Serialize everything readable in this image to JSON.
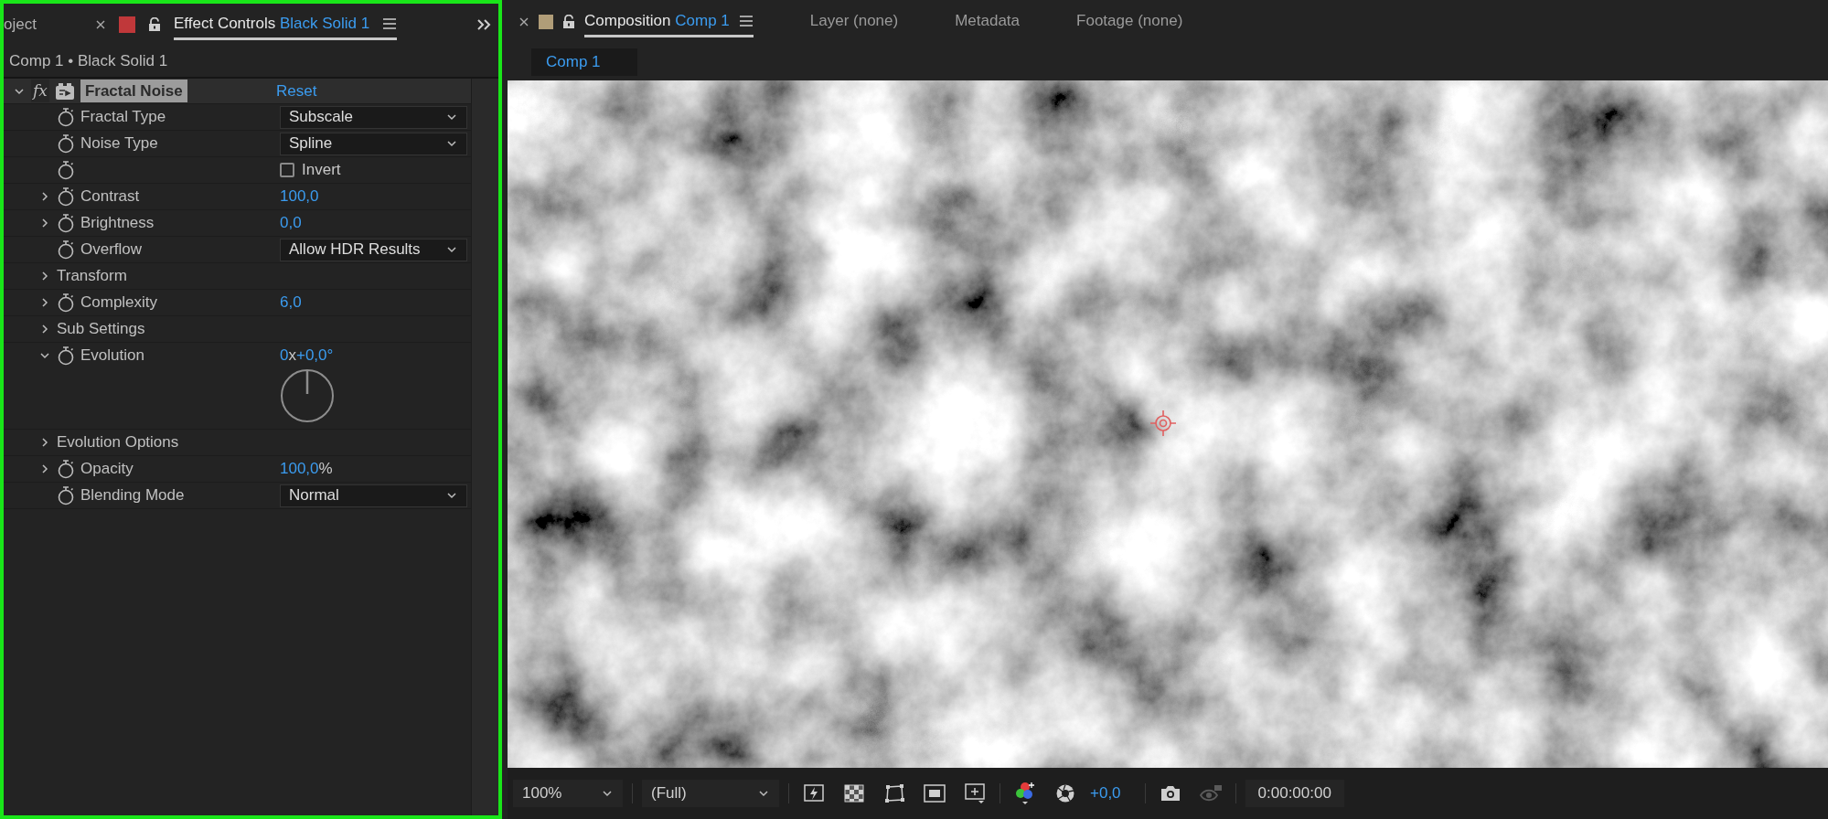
{
  "effect_panel": {
    "cut_tab": "oject",
    "tab": {
      "title": "Effect Controls",
      "subject": "Black Solid 1",
      "selected": true,
      "color": "#c0383a"
    },
    "breadcrumb": "Comp 1 • Black Solid 1",
    "effect": {
      "fx_label": "fx",
      "name": "Fractal Noise",
      "reset": "Reset",
      "expanded": true
    },
    "properties": [
      {
        "kind": "dropdown",
        "label": "Fractal Type",
        "expandable": false,
        "stopwatch": true,
        "value": "Subscale"
      },
      {
        "kind": "dropdown",
        "label": "Noise Type",
        "expandable": false,
        "stopwatch": true,
        "value": "Spline"
      },
      {
        "kind": "checkbox",
        "label": "Invert",
        "expandable": false,
        "stopwatch": true,
        "checked": false
      },
      {
        "kind": "number",
        "label": "Contrast",
        "expandable": true,
        "expanded": false,
        "stopwatch": true,
        "value": [
          {
            "text": "100,0",
            "accent": true
          }
        ]
      },
      {
        "kind": "number",
        "label": "Brightness",
        "expandable": true,
        "expanded": false,
        "stopwatch": true,
        "value": [
          {
            "text": "0,0",
            "accent": true
          }
        ]
      },
      {
        "kind": "dropdown",
        "label": "Overflow",
        "expandable": false,
        "stopwatch": true,
        "value": "Allow HDR Results"
      },
      {
        "kind": "group",
        "label": "Transform",
        "expandable": true,
        "expanded": false,
        "stopwatch": false
      },
      {
        "kind": "number",
        "label": "Complexity",
        "expandable": true,
        "expanded": false,
        "stopwatch": true,
        "value": [
          {
            "text": "6,0",
            "accent": true
          }
        ]
      },
      {
        "kind": "group",
        "label": "Sub Settings",
        "expandable": true,
        "expanded": false,
        "stopwatch": false
      },
      {
        "kind": "angle",
        "label": "Evolution",
        "expandable": true,
        "expanded": true,
        "stopwatch": true,
        "value": [
          {
            "text": "0",
            "accent": true
          },
          {
            "text": "x",
            "accent": false
          },
          {
            "text": "+0,0°",
            "accent": true
          }
        ]
      },
      {
        "kind": "group",
        "label": "Evolution Options",
        "expandable": true,
        "expanded": false,
        "stopwatch": false
      },
      {
        "kind": "number",
        "label": "Opacity",
        "expandable": true,
        "expanded": false,
        "stopwatch": true,
        "value": [
          {
            "text": "100,0",
            "accent": true
          },
          {
            "text": "%",
            "accent": false
          }
        ]
      },
      {
        "kind": "dropdown",
        "label": "Blending Mode",
        "expandable": false,
        "stopwatch": true,
        "value": "Normal"
      }
    ]
  },
  "comp_panel": {
    "tabs": [
      {
        "title": "Composition",
        "subject": "Comp 1",
        "selected": true,
        "color": "#b09d78"
      },
      {
        "title": "Layer (none)",
        "selected": false
      },
      {
        "title": "Metadata",
        "selected": false
      },
      {
        "title": "Footage (none)",
        "selected": false
      }
    ],
    "subtab": "Comp 1",
    "toolbar": {
      "zoom": "100%",
      "resolution": "(Full)",
      "exposure": "+0,0",
      "timecode": "0:00:00:00"
    }
  }
}
